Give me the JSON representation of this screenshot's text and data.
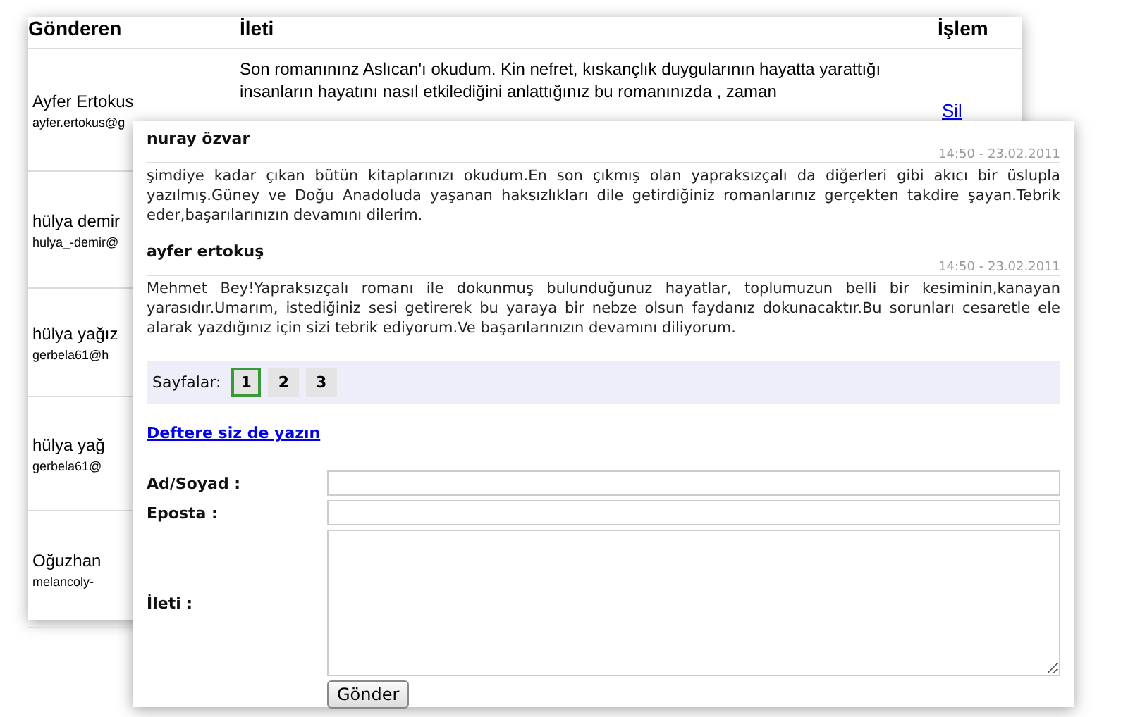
{
  "back_table": {
    "columns": [
      "Gönderen",
      "İleti",
      "İşlem"
    ],
    "rows": [
      {
        "name": "Ayfer Ertokus",
        "email": "ayfer.ertokus@g",
        "message": [
          "Son romanınınz Aslıcan'ı okudum. Kin nefret, kıskançlık duygularının hayatta yarattığı",
          "insanların hayatını nasıl etkilediğini anlattığınız bu romanınızda , zaman"
        ],
        "action": "Sil"
      },
      {
        "name": "hülya demir",
        "email": "hulya_-demir@"
      },
      {
        "name": "hülya yağız",
        "email": "gerbela61@h"
      },
      {
        "name": "hülya yağ",
        "email": "gerbela61@"
      },
      {
        "name": "Oğuzhan",
        "email": "melancoly-"
      }
    ]
  },
  "guestbook": {
    "entries": [
      {
        "author": "nuray özvar",
        "time": "14:50 - 23.02.2011",
        "text": "şimdiye kadar çıkan bütün kitaplarınızı okudum.En son çıkmış olan yapraksızçalı da diğerleri gibi akıcı bir üslupla yazılmış.Güney ve Doğu Anadoluda yaşanan haksızlıkları dile getirdiğiniz romanlarınız gerçekten takdire şayan.Tebrik eder,başarılarınızın devamını dilerim."
      },
      {
        "author": "ayfer ertokuş",
        "time": "14:50 - 23.02.2011",
        "text": "Mehmet Bey!Yapraksızçalı romanı ile dokunmuş bulunduğunuz hayatlar, toplumuzun belli bir kesiminin,kanayan yarasıdır.Umarım, istediğiniz sesi getirerek bu yaraya bir nebze olsun faydanız dokunacaktır.Bu sorunları cesaretle ele alarak yazdığınız için sizi tebrik ediyorum.Ve başarılarınızın devamını diliyorum."
      }
    ],
    "pagination": {
      "label": "Sayfalar:",
      "pages": [
        {
          "label": "1",
          "selected": true
        },
        {
          "label": "2",
          "selected": false
        },
        {
          "label": "3",
          "selected": false
        }
      ]
    },
    "write_link": "Deftere siz de yazın",
    "form": {
      "fields": [
        {
          "label": "Ad/Soyad :",
          "kind": "input"
        },
        {
          "label": "Eposta :",
          "kind": "input"
        },
        {
          "label": "İleti :",
          "kind": "textarea"
        }
      ],
      "submit": "Gönder"
    }
  }
}
